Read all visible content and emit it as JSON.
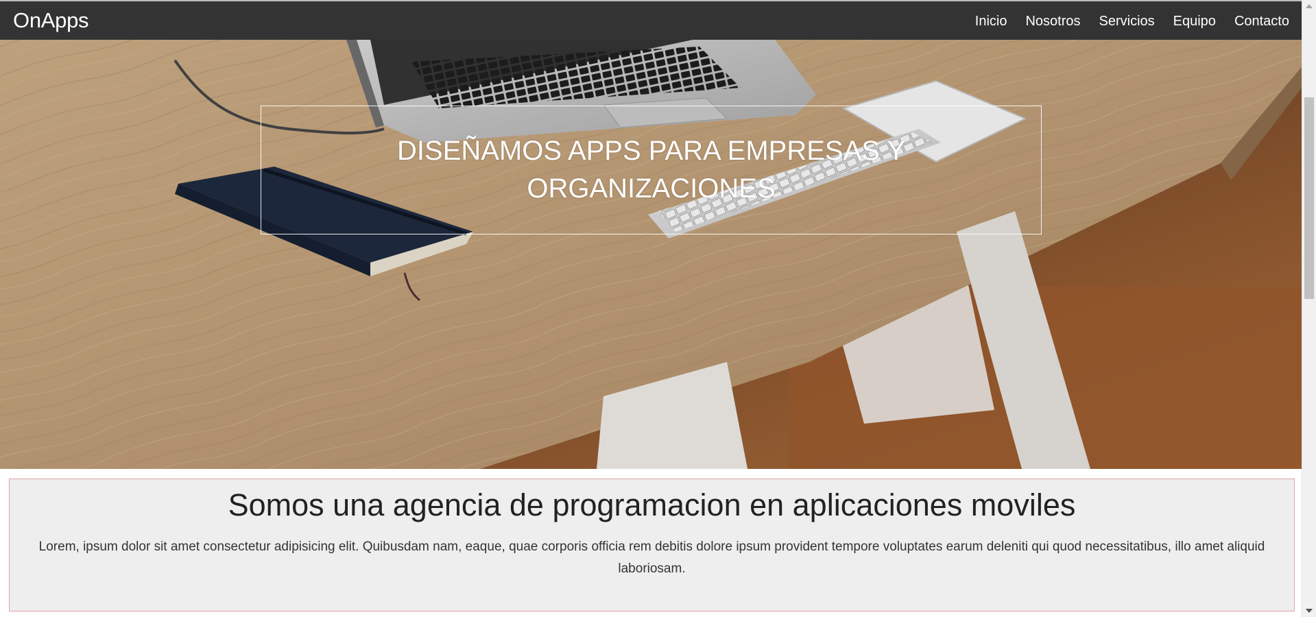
{
  "brand": {
    "name": "OnApps"
  },
  "nav": {
    "items": [
      {
        "label": "Inicio"
      },
      {
        "label": "Nosotros"
      },
      {
        "label": "Servicios"
      },
      {
        "label": "Equipo"
      },
      {
        "label": "Contacto"
      }
    ]
  },
  "hero": {
    "title": "DISEÑAMOS APPS PARA EMPRESAS Y ORGANIZACIONES"
  },
  "about": {
    "title": "Somos una agencia de programacion en aplicaciones moviles",
    "text": "Lorem, ipsum dolor sit amet consectetur adipisicing elit. Quibusdam nam, eaque, quae corporis officia rem debitis dolore ipsum provident tempore voluptates earum deleniti qui quod necessitatibus, illo amet aliquid laboriosam."
  },
  "colors": {
    "navbar_bg": "#333333",
    "about_bg": "#edeeed",
    "about_border": "#e4a0a8",
    "text_light": "#ffffff"
  }
}
